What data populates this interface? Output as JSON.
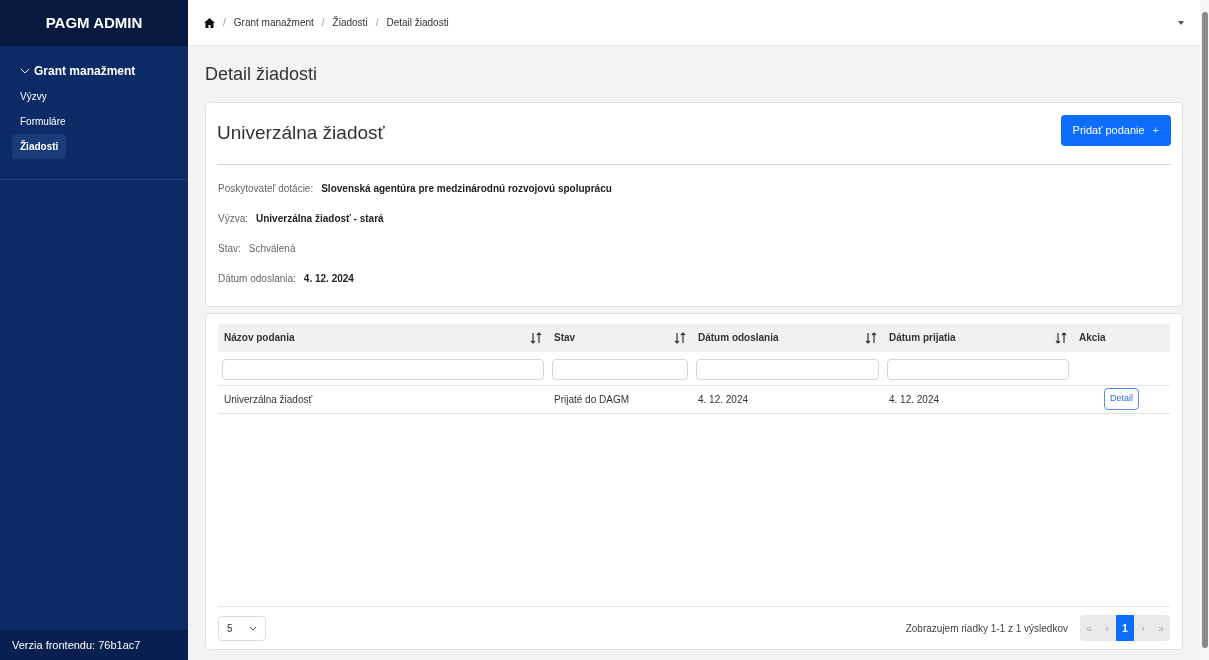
{
  "sidebar": {
    "title": "PAGM ADMIN",
    "group": {
      "label": "Grant manažment",
      "expanded": true,
      "items": [
        {
          "label": "Výzvy",
          "selected": false
        },
        {
          "label": "Formuláre",
          "selected": false
        },
        {
          "label": "Žiadosti",
          "selected": true
        }
      ]
    },
    "footer": "Verzia frontendu: 76b1ac7"
  },
  "breadcrumb": [
    {
      "separator": "/",
      "label": "Grant manažment"
    },
    {
      "separator": "/",
      "label": "Žiadosti"
    },
    {
      "separator": "/",
      "label": "Detail žiadosti"
    }
  ],
  "page_title": "Detail žiadosti",
  "detail": {
    "title": "Univerzálna žiadosť",
    "add_button": "Pridať podanie",
    "add_icon": "+",
    "fields": [
      {
        "label": "Poskytovateľ dotácie:",
        "value": "Slovenská agentúra pre medzinárodnú rozvojovú spoluprácu",
        "bold": true
      },
      {
        "label": "Výzva:",
        "value": "Univerzálna žiadosť - stará",
        "bold": true
      },
      {
        "label": "Stav:",
        "value": "Schválená",
        "bold": false
      },
      {
        "label": "Dátum odoslania:",
        "value": "4. 12. 2024",
        "bold": true
      }
    ]
  },
  "table": {
    "columns": [
      {
        "label": "Názov podania",
        "sortable": true,
        "filter": true
      },
      {
        "label": "Stav",
        "sortable": true,
        "filter": true
      },
      {
        "label": "Dátum odoslania",
        "sortable": true,
        "filter": true
      },
      {
        "label": "Dátum prijatia",
        "sortable": true,
        "filter": true
      },
      {
        "label": "Akcia",
        "sortable": false,
        "filter": false
      }
    ],
    "rows": [
      {
        "cells": [
          "Univerzálna žiadosť",
          "Prijaté do DAGM",
          "4. 12. 2024",
          "4. 12. 2024"
        ],
        "action": "Detail"
      }
    ],
    "page_size": "5",
    "summary": "Zobrazujem riadky 1-1 z 1 výsledkov",
    "pages": [
      {
        "label": "«",
        "selected": false,
        "disabled": true
      },
      {
        "label": "‹",
        "selected": false,
        "disabled": true
      },
      {
        "label": "1",
        "selected": true,
        "disabled": false
      },
      {
        "label": "›",
        "selected": false,
        "disabled": true
      },
      {
        "label": "»",
        "selected": false,
        "disabled": true
      }
    ]
  }
}
